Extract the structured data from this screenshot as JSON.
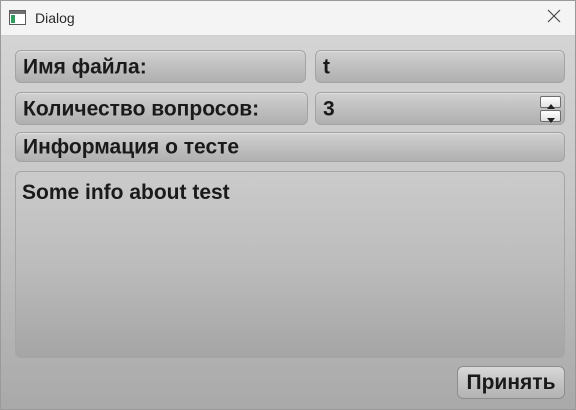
{
  "window": {
    "title": "Dialog",
    "icons": {
      "app": "dialog-window-icon",
      "close": "close-icon"
    }
  },
  "form": {
    "filename_label": "Имя файла:",
    "filename_value": "t",
    "questions_label": "Количество вопросов:",
    "questions_value": "3",
    "info_header": "Информация о тесте",
    "info_text": "Some info about test"
  },
  "buttons": {
    "accept_label": "Принять"
  },
  "colors": {
    "titlebar": "#f4f4f4",
    "content_top": "#d4d4d4",
    "content_bottom": "#a9a9a9",
    "text": "#1a1a1a"
  }
}
